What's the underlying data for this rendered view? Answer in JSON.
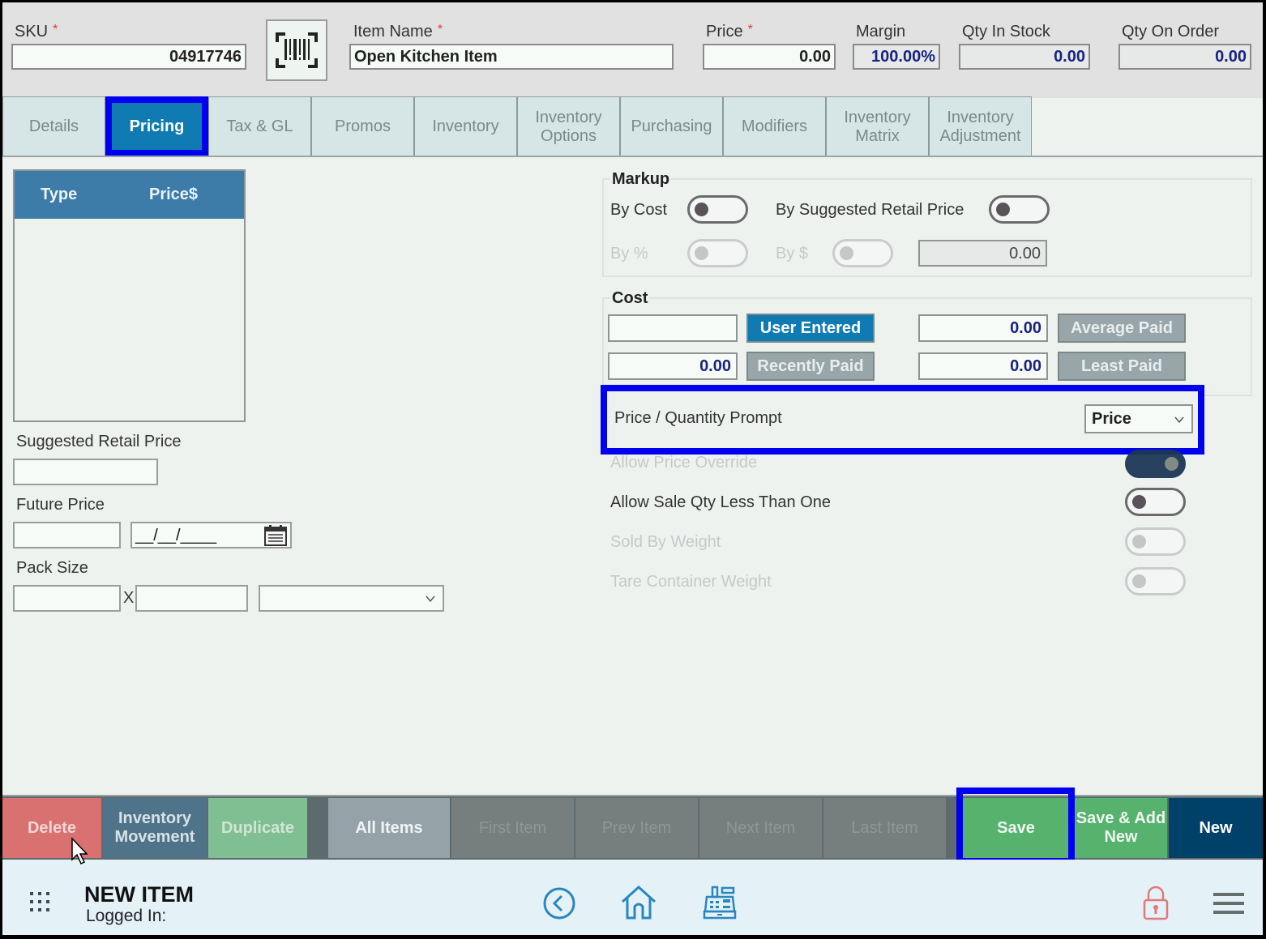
{
  "header": {
    "sku_label": "SKU",
    "sku_value": "04917746",
    "barcode_icon": "barcode-scan-icon",
    "item_name_label": "Item Name",
    "item_name_value": "Open Kitchen Item",
    "price_label": "Price",
    "price_value": "0.00",
    "margin_label": "Margin",
    "margin_value": "100.00%",
    "qty_in_stock_label": "Qty In Stock",
    "qty_in_stock_value": "0.00",
    "qty_on_order_label": "Qty On Order",
    "qty_on_order_value": "0.00",
    "required_mark": "*"
  },
  "tabs": [
    {
      "label": "Details",
      "active": false
    },
    {
      "label": "Pricing",
      "active": true
    },
    {
      "label": "Tax & GL",
      "active": false
    },
    {
      "label": "Promos",
      "active": false
    },
    {
      "label": "Inventory",
      "active": false
    },
    {
      "label": "Inventory Options",
      "active": false
    },
    {
      "label": "Purchasing",
      "active": false
    },
    {
      "label": "Modifiers",
      "active": false
    },
    {
      "label": "Inventory Matrix",
      "active": false
    },
    {
      "label": "Inventory Adjustment",
      "active": false
    }
  ],
  "price_grid": {
    "columns": [
      "Type",
      "Price$"
    ],
    "rows": []
  },
  "left": {
    "suggested_retail_label": "Suggested Retail Price",
    "suggested_retail_value": "",
    "future_price_label": "Future Price",
    "future_price_value": "",
    "future_date_value": "__/__/____",
    "pack_size_label": "Pack Size",
    "pack_size_x": "X",
    "pack_qty_value": "",
    "pack_size_value": "",
    "pack_unit_value": ""
  },
  "markup": {
    "legend": "Markup",
    "by_cost_label": "By Cost",
    "by_cost_on": false,
    "by_srp_label": "By Suggested Retail Price",
    "by_srp_on": false,
    "by_pct_label": "By %",
    "by_pct_on": false,
    "by_dollar_label": "By $",
    "by_dollar_on": false,
    "markup_value": "0.00"
  },
  "cost": {
    "legend": "Cost",
    "user_entered_value": "",
    "user_entered_label": "User Entered",
    "average_paid_value": "0.00",
    "average_paid_label": "Average Paid",
    "recently_paid_value": "0.00",
    "recently_paid_label": "Recently Paid",
    "least_paid_value": "0.00",
    "least_paid_label": "Least Paid"
  },
  "options": {
    "pq_prompt_label": "Price / Quantity Prompt",
    "pq_prompt_value": "Price",
    "allow_price_override_label": "Allow Price Override",
    "allow_price_override_on": true,
    "allow_sale_qty_label": "Allow Sale Qty Less Than One",
    "allow_sale_qty_on": false,
    "sold_by_weight_label": "Sold By Weight",
    "sold_by_weight_on": false,
    "tare_container_label": "Tare Container Weight",
    "tare_container_on": false
  },
  "actions": {
    "delete": "Delete",
    "inventory_movement": "Inventory Movement",
    "duplicate": "Duplicate",
    "all_items": "All Items",
    "first_item": "First Item",
    "prev_item": "Prev Item",
    "next_item": "Next Item",
    "last_item": "Last Item",
    "save": "Save",
    "save_add_new": "Save & Add New",
    "new": "New"
  },
  "footer": {
    "title": "NEW ITEM",
    "logged_in": "Logged In:",
    "icons": [
      "apps-grid-icon",
      "back-circle-icon",
      "home-icon",
      "cash-register-icon",
      "lock-icon",
      "hamburger-menu-icon"
    ]
  },
  "colors": {
    "active_tab": "#0f7bb2",
    "highlight": "#0000f0",
    "delete": "#d97171",
    "inventory_movement": "#4f7489",
    "duplicate": "#80bf92",
    "save": "#57b26e",
    "new": "#004169"
  }
}
